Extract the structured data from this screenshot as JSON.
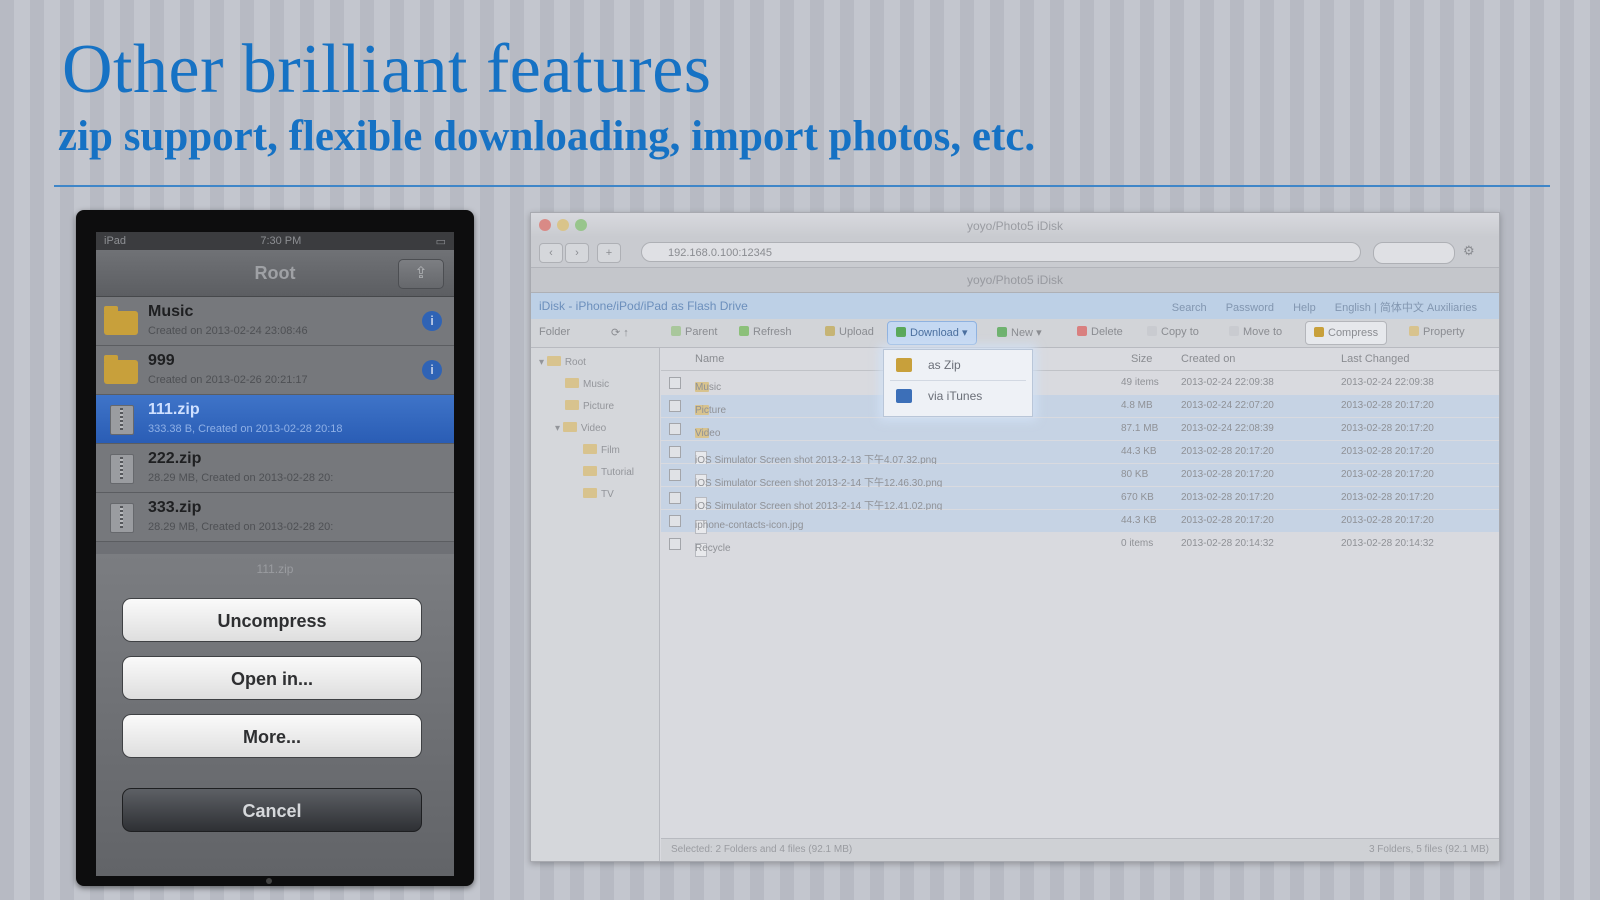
{
  "headline": "Other brilliant features",
  "subheadline": "zip support, flexible downloading, import photos, etc.",
  "colors": {
    "accent": "#1672c4",
    "ios_selection": "#2f63b5",
    "folder": "#c8a03b"
  },
  "ipad": {
    "status_left": "iPad",
    "status_time": "7:30 PM",
    "nav_title": "Root",
    "nav_action_icon": "action-icon",
    "files": [
      {
        "name": "Music",
        "subtitle": "Created on 2013-02-24 23:08:46",
        "kind": "folder",
        "selected": false,
        "info": true
      },
      {
        "name": "999",
        "subtitle": "Created on 2013-02-26 20:21:17",
        "kind": "folder",
        "selected": false,
        "info": true
      },
      {
        "name": "111.zip",
        "subtitle": "333.38 B, Created on 2013-02-28 20:18",
        "kind": "zip",
        "selected": true,
        "info": false
      },
      {
        "name": "222.zip",
        "subtitle": "28.29 MB, Created on 2013-02-28 20:",
        "kind": "zip",
        "selected": false,
        "info": false
      },
      {
        "name": "333.zip",
        "subtitle": "28.29 MB, Created on 2013-02-28 20:",
        "kind": "zip",
        "selected": false,
        "info": false
      }
    ],
    "sheet_title": "111.zip",
    "buttons": {
      "uncompress": "Uncompress",
      "open_in": "Open in...",
      "more": "More...",
      "cancel": "Cancel"
    }
  },
  "browser": {
    "window_title": "yoyo/Photo5 iDisk",
    "url": "192.168.0.100:12345",
    "tab_title": "yoyo/Photo5 iDisk",
    "breadcrumb": "iDisk - iPhone/iPod/iPad as Flash Drive",
    "header_links": [
      "Search",
      "Password",
      "Help",
      "English | 简体中文 Auxiliaries"
    ],
    "toolbar": {
      "folder_label": "Folder",
      "parent": "Parent",
      "refresh": "Refresh",
      "upload": "Upload",
      "download": "Download",
      "new": "New",
      "delete": "Delete",
      "copy_to": "Copy to",
      "move_to": "Move to",
      "compress": "Compress",
      "property": "Property"
    },
    "tree": [
      "Root",
      "Music",
      "Picture",
      "Video",
      "Film",
      "Tutorial",
      "TV"
    ],
    "columns": {
      "name": "Name",
      "size": "Size",
      "created": "Created on",
      "changed": "Last Changed"
    },
    "rows": [
      {
        "name": "Music",
        "size": "49 items",
        "created": "2013-02-24 22:09:38",
        "changed": "2013-02-24 22:09:38",
        "kind": "folder",
        "selected": false
      },
      {
        "name": "Picture",
        "size": "4.8 MB",
        "created": "2013-02-24 22:07:20",
        "changed": "2013-02-28 20:17:20",
        "kind": "folder",
        "selected": true
      },
      {
        "name": "Video",
        "size": "87.1 MB",
        "created": "2013-02-24 22:08:39",
        "changed": "2013-02-28 20:17:20",
        "kind": "folder",
        "selected": true
      },
      {
        "name": "iOS Simulator Screen shot 2013-2-13 下午4.07.32.png",
        "size": "44.3 KB",
        "created": "2013-02-28 20:17:20",
        "changed": "2013-02-28 20:17:20",
        "kind": "file",
        "selected": true
      },
      {
        "name": "iOS Simulator Screen shot 2013-2-14 下午12.46.30.png",
        "size": "80 KB",
        "created": "2013-02-28 20:17:20",
        "changed": "2013-02-28 20:17:20",
        "kind": "file",
        "selected": true
      },
      {
        "name": "iOS Simulator Screen shot 2013-2-14 下午12.41.02.png",
        "size": "670 KB",
        "created": "2013-02-28 20:17:20",
        "changed": "2013-02-28 20:17:20",
        "kind": "file",
        "selected": true
      },
      {
        "name": "iphone-contacts-icon.jpg",
        "size": "44.3 KB",
        "created": "2013-02-28 20:17:20",
        "changed": "2013-02-28 20:17:20",
        "kind": "file",
        "selected": true
      },
      {
        "name": "Recycle",
        "size": "0 items",
        "created": "2013-02-28 20:14:32",
        "changed": "2013-02-28 20:14:32",
        "kind": "file",
        "selected": false
      }
    ],
    "dropdown": [
      {
        "label": "as Zip",
        "icon": "zip-icon"
      },
      {
        "label": "via iTunes",
        "icon": "itunes-icon"
      }
    ],
    "status_left": "Selected: 2 Folders and 4 files (92.1 MB)",
    "status_right": "3 Folders, 5 files (92.1 MB)"
  }
}
